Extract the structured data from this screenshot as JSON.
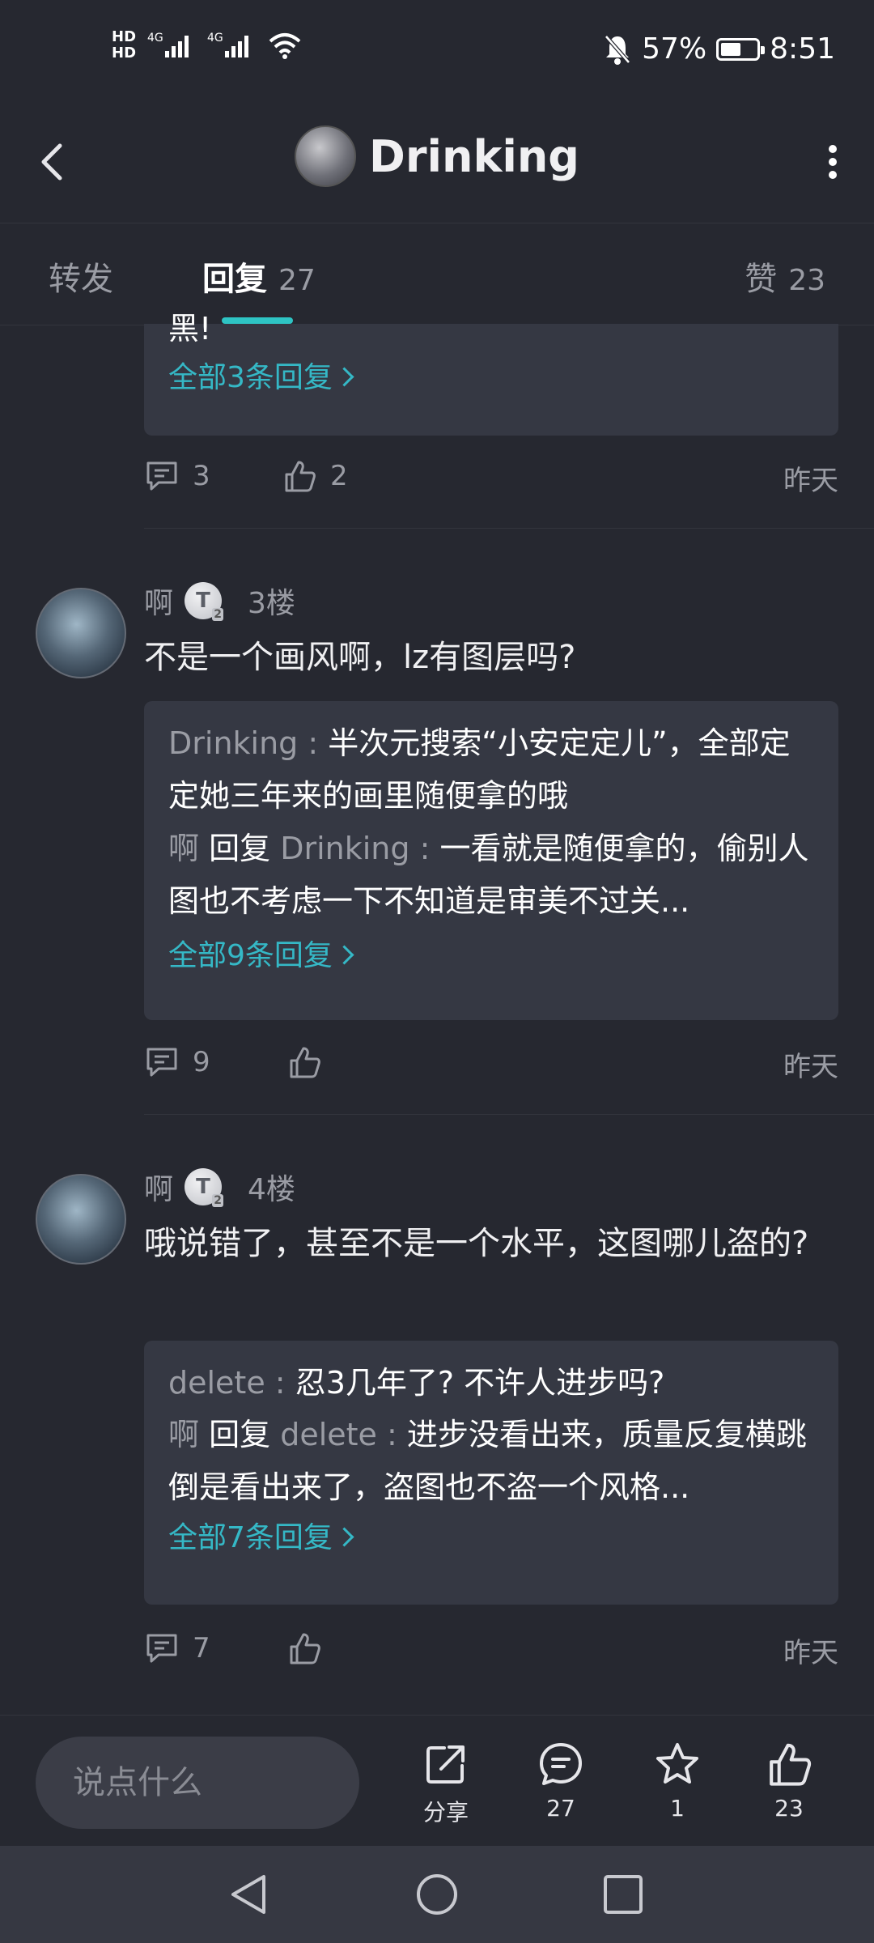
{
  "status_bar": {
    "signal_text": "HD 4G 4G",
    "battery_percent": "57%",
    "time": "8:51",
    "battery_level": 0.57
  },
  "header": {
    "title": "Drinking"
  },
  "tabs": {
    "forward": "转发",
    "reply": "回复",
    "reply_count": "27",
    "like": "赞",
    "like_count": "23"
  },
  "comments": [
    {
      "partial_text": "黑!",
      "more_link": "全部3条回复",
      "reply_count": "3",
      "like_count": "2",
      "time": "昨天"
    },
    {
      "author": "啊",
      "badge": "T",
      "badge_level": "2",
      "floor": "3楼",
      "text": "不是一个画风啊，lz有图层吗?",
      "replies": [
        {
          "author": "Drinking",
          "sep": " : ",
          "text": "半次元搜索“小安定定儿”，全部定定她三年来的画里随便拿的哦"
        },
        {
          "author": "啊",
          "reply_word": "回复",
          "target": "Drinking",
          "sep": " : ",
          "text": "一看就是随便拿的，偷别人图也不考虑一下不知道是审美不过关..."
        }
      ],
      "more_link": "全部9条回复",
      "reply_count": "9",
      "time": "昨天"
    },
    {
      "author": "啊",
      "badge": "T",
      "badge_level": "2",
      "floor": "4楼",
      "text": "哦说错了，甚至不是一个水平，这图哪儿盗的?",
      "replies": [
        {
          "author": "delete",
          "sep": " : ",
          "text": "忍3几年了? 不许人进步吗?"
        },
        {
          "author": "啊",
          "reply_word": "回复",
          "target": "delete",
          "sep": " : ",
          "text": "进步没看出来，质量反复横跳倒是看出来了，盗图也不盗一个风格..."
        }
      ],
      "more_link": "全部7条回复",
      "reply_count": "7",
      "time": "昨天"
    }
  ],
  "bottom_bar": {
    "input_placeholder": "说点什么",
    "share_label": "分享",
    "comment_count": "27",
    "favorite_count": "1",
    "like_count": "23"
  },
  "colors": {
    "background": "#262830",
    "card": "#353843",
    "accent": "#2ec4c4",
    "link": "#35b8c6"
  }
}
